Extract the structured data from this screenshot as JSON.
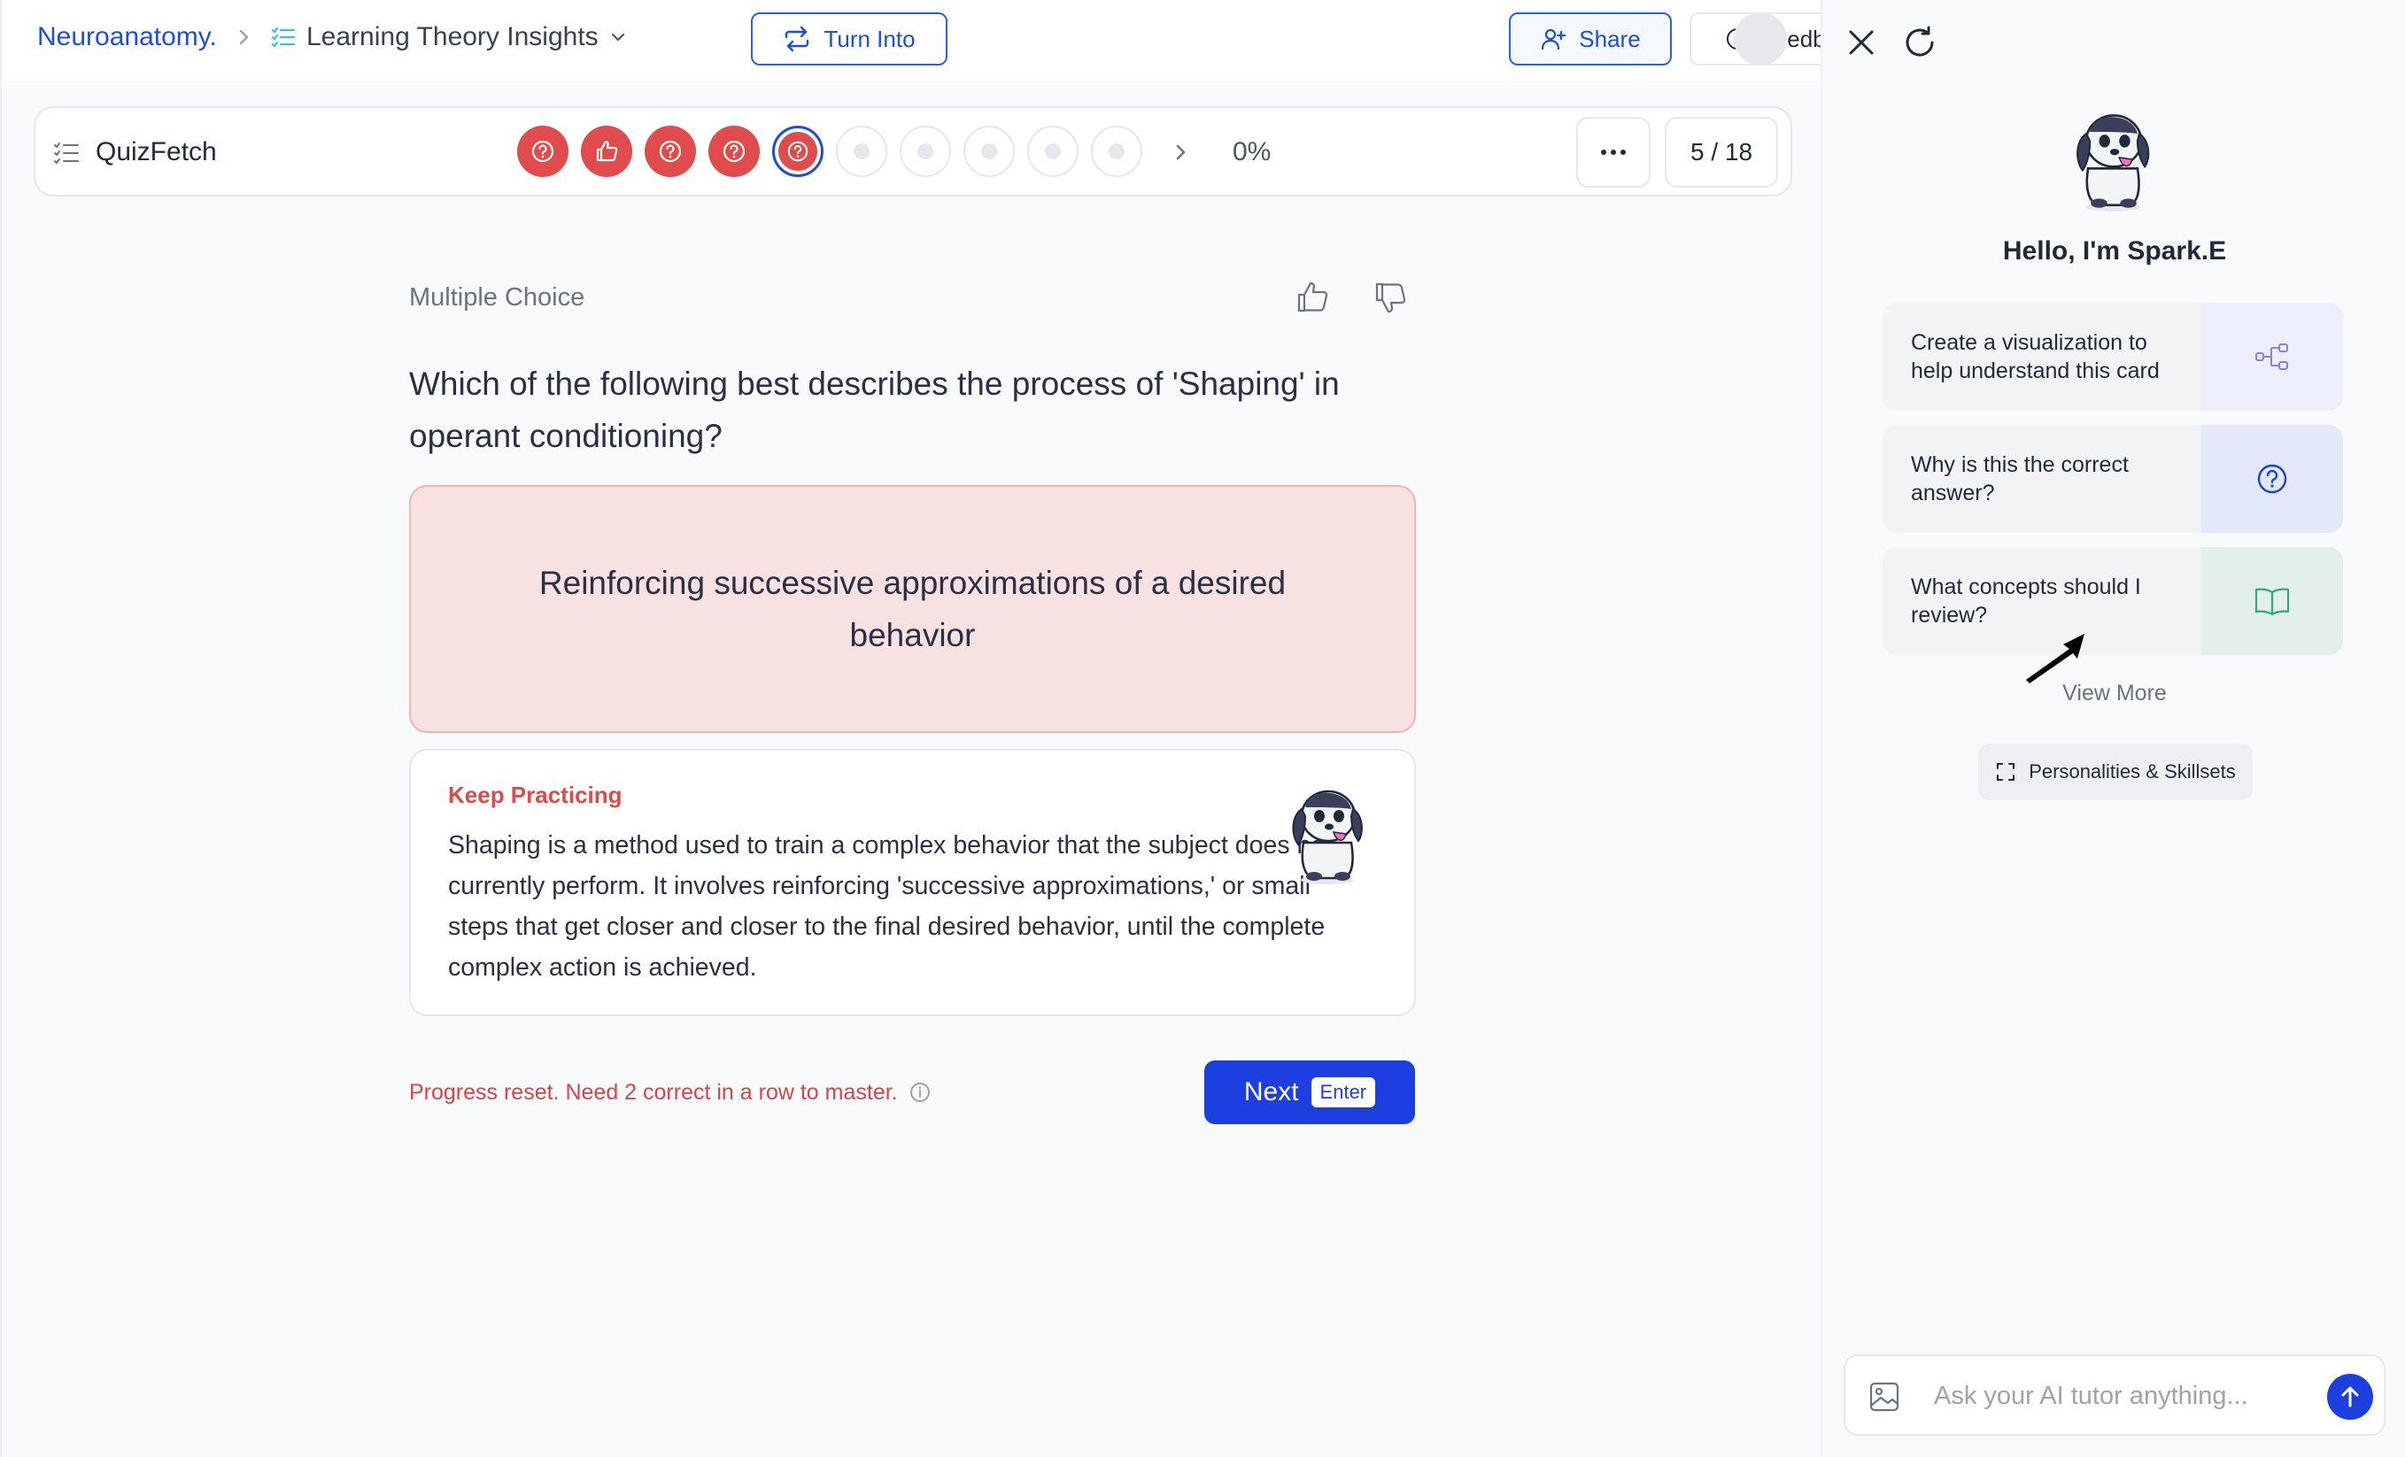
{
  "breadcrumb": {
    "root": "Neuroanatomy.",
    "deck": "Learning Theory Insights"
  },
  "header": {
    "turn_into": "Turn Into",
    "share": "Share",
    "feedback": "Feedback"
  },
  "quiz": {
    "title": "QuizFetch",
    "progress_percent": "0%",
    "counter": "5 / 18",
    "dots": [
      "incorrect",
      "correct",
      "incorrect",
      "incorrect",
      "current-incorrect",
      "empty",
      "empty",
      "empty",
      "empty",
      "empty"
    ]
  },
  "question": {
    "type": "Multiple Choice",
    "text": "Which of the following best describes the process of 'Shaping' in operant conditioning?",
    "selected_answer": "Reinforcing successive approximations of a desired behavior"
  },
  "feedback_card": {
    "title": "Keep Practicing",
    "body": "Shaping is a method used to train a complex behavior that the subject does not currently perform. It involves reinforcing 'successive approximations,' or small steps that get closer and closer to the final desired behavior, until the complete complex action is achieved."
  },
  "footer": {
    "reset_message": "Progress reset. Need 2 correct in a row to master.",
    "next_label": "Next",
    "next_key": "Enter"
  },
  "panel": {
    "greeting": "Hello, I'm Spark.E",
    "suggestions": [
      {
        "label": "Create a visualization to help understand this card",
        "icon": "flowchart-icon",
        "color": "#eceefb"
      },
      {
        "label": "Why is this the correct answer?",
        "icon": "question-circle-icon",
        "color": "#e3e8fb"
      },
      {
        "label": "What concepts should I review?",
        "icon": "open-book-icon",
        "color": "#e3f0ea"
      }
    ],
    "view_more": "View More",
    "personalities": "Personalities & Skillsets",
    "chat_placeholder": "Ask your AI tutor anything..."
  },
  "colors": {
    "accent": "#1d3fe0",
    "incorrect": "#e04b4b",
    "incorrect_bg": "#f8e1e1"
  }
}
